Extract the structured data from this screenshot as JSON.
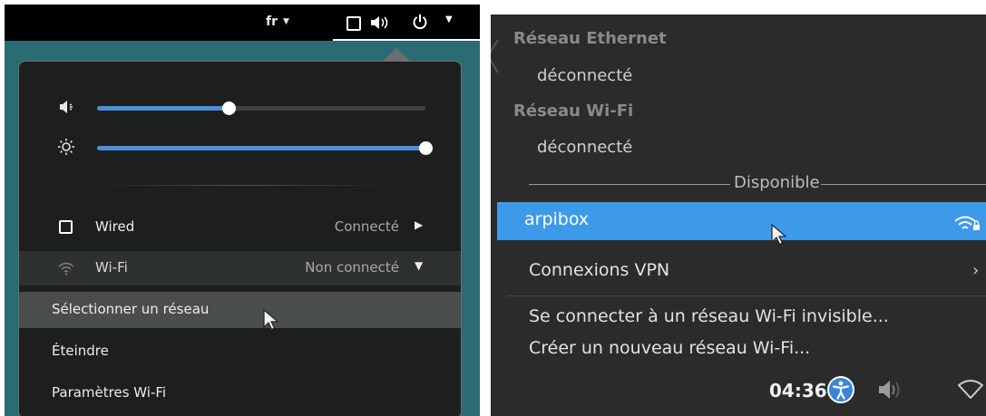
{
  "gnome": {
    "topbar": {
      "language": "fr",
      "language_caret": "▼",
      "menu_caret": "▼"
    },
    "sliders": [
      {
        "icon": "volume-icon",
        "level": 0.4
      },
      {
        "icon": "brightness-icon",
        "level": 1.0
      }
    ],
    "wired": {
      "label": "Wired",
      "status": "Connecté",
      "chevron": "▶"
    },
    "wifi": {
      "label": "Wi-Fi",
      "status": "Non connecté",
      "chevron": "▼"
    },
    "submenu": [
      {
        "label": "Sélectionner un réseau"
      },
      {
        "label": "Éteindre"
      },
      {
        "label": "Paramètres Wi-Fi"
      }
    ]
  },
  "kde": {
    "ethernet_header": "Réseau Ethernet",
    "ethernet_status": "déconnecté",
    "wifi_header": "Réseau Wi-Fi",
    "wifi_status": "déconnecté",
    "available_label": "Disponible",
    "network_name": "arpibox",
    "vpn_label": "Connexions VPN",
    "vpn_chevron": "›",
    "hidden_wifi": "Se connecter à un réseau Wi-Fi invisible...",
    "new_wifi": "Créer un nouveau réseau Wi-Fi...",
    "clock": "04:36"
  },
  "colors": {
    "accent": "#4a90d9",
    "kde_highlight": "#3d9ae8",
    "teal_bg": "#2a6b74"
  }
}
